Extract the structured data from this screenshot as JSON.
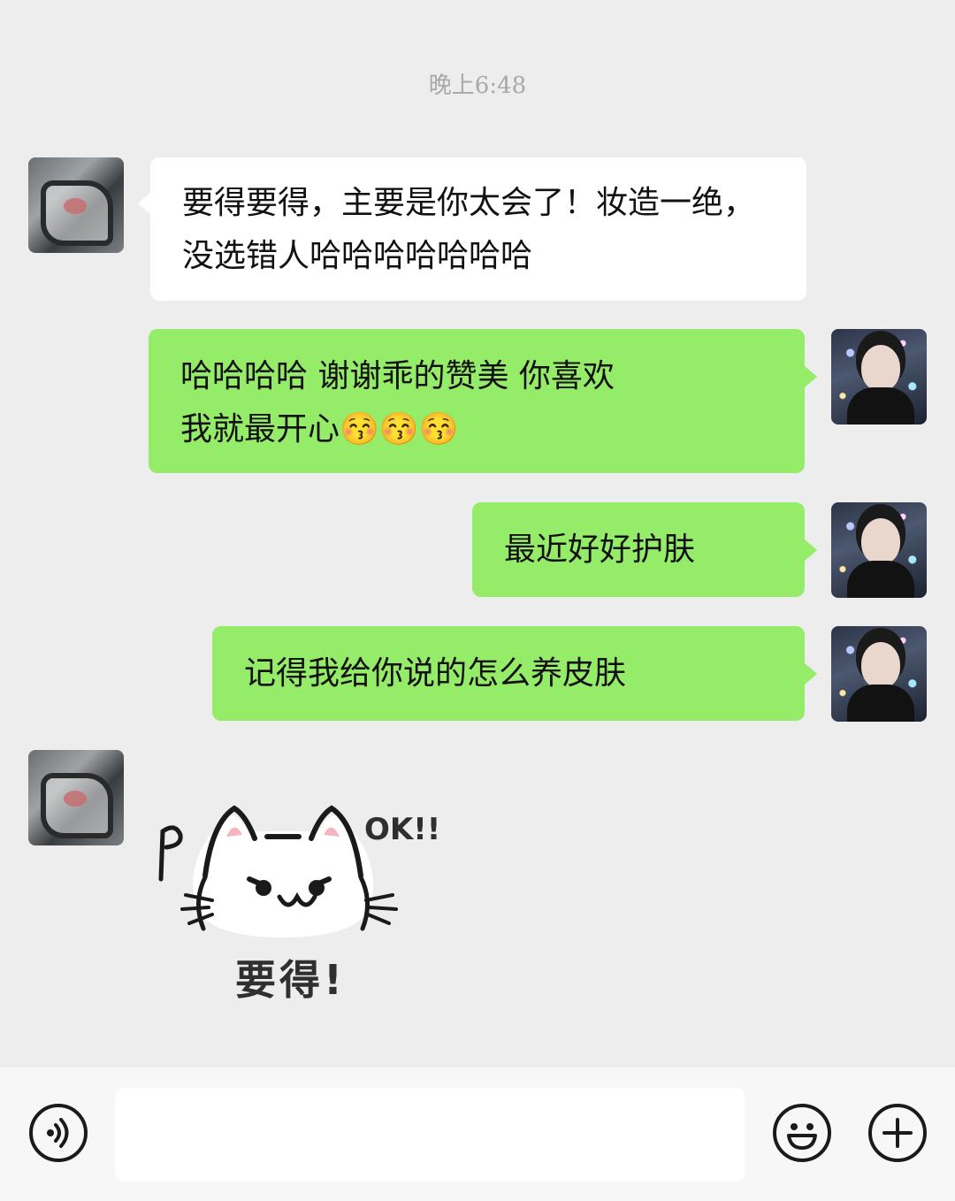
{
  "chat": {
    "timestamp": "晚上6:48",
    "messages": [
      {
        "sender": "peer",
        "text": "要得要得，主要是你太会了！妆造一绝，没选错人哈哈哈哈哈哈哈"
      },
      {
        "sender": "self",
        "line1": "哈哈哈哈 谢谢乖的赞美  你喜欢",
        "line2": "我就最开心😚😚😚"
      },
      {
        "sender": "self",
        "text": "最近好好护肤"
      },
      {
        "sender": "self",
        "text": "记得我给你说的怎么养皮肤"
      },
      {
        "sender": "peer",
        "type": "sticker",
        "sticker_text": "要得!",
        "sticker_ok": "OK!!"
      }
    ]
  },
  "input_bar": {
    "value": "",
    "voice_icon": "voice-icon",
    "emoji_icon": "emoji-icon",
    "plus_icon": "plus-icon"
  }
}
